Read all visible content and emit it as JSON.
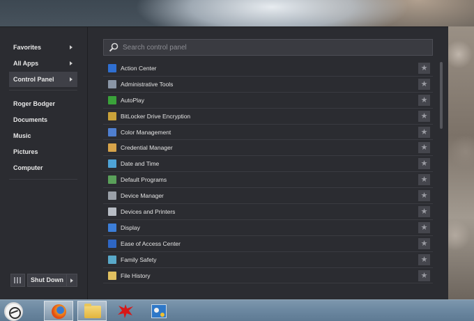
{
  "left_nav": {
    "favorites": "Favorites",
    "all_apps": "All Apps",
    "control_panel": "Control Panel",
    "links": [
      "Roger Bodger",
      "Documents",
      "Music",
      "Pictures",
      "Computer"
    ],
    "shutdown_label": "Shut Down"
  },
  "search": {
    "placeholder": "Search control panel"
  },
  "control_panel_items": [
    {
      "label": "Action Center",
      "icon": "flag-icon",
      "color": "#2f6fd1"
    },
    {
      "label": "Administrative Tools",
      "icon": "admin-tools-icon",
      "color": "#8a96a6"
    },
    {
      "label": "AutoPlay",
      "icon": "autoplay-icon",
      "color": "#3aa23a"
    },
    {
      "label": "BitLocker Drive Encryption",
      "icon": "bitlocker-icon",
      "color": "#c9a23a"
    },
    {
      "label": "Color Management",
      "icon": "color-management-icon",
      "color": "#4f7fd0"
    },
    {
      "label": "Credential Manager",
      "icon": "credential-icon",
      "color": "#d7a44a"
    },
    {
      "label": "Date and Time",
      "icon": "clock-icon",
      "color": "#4ea3d6"
    },
    {
      "label": "Default Programs",
      "icon": "default-programs-icon",
      "color": "#5aa05a"
    },
    {
      "label": "Device Manager",
      "icon": "device-manager-icon",
      "color": "#9aa0a8"
    },
    {
      "label": "Devices and Printers",
      "icon": "printer-icon",
      "color": "#b7bcc4"
    },
    {
      "label": "Display",
      "icon": "display-icon",
      "color": "#3c7ed8"
    },
    {
      "label": "Ease of Access Center",
      "icon": "ease-of-access-icon",
      "color": "#2e66c4"
    },
    {
      "label": "Family Safety",
      "icon": "family-safety-icon",
      "color": "#59a9c9"
    },
    {
      "label": "File History",
      "icon": "file-history-icon",
      "color": "#e0c060"
    }
  ],
  "taskbar": {
    "apps": [
      "firefox-icon",
      "file-explorer-icon",
      "splat-app-icon",
      "control-panel-icon"
    ]
  }
}
